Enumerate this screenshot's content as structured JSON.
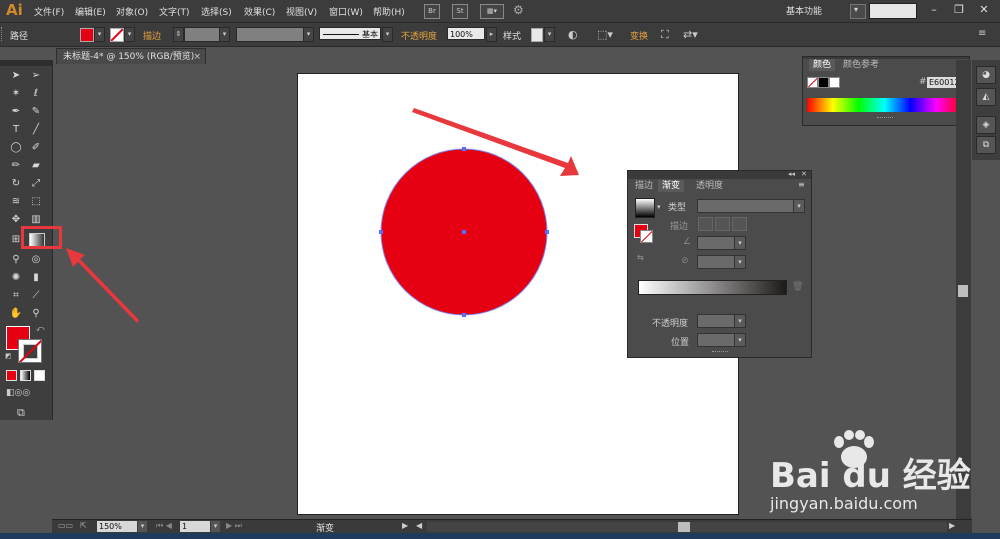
{
  "app": {
    "logo": "Ai"
  },
  "menu": [
    "文件(F)",
    "编辑(E)",
    "对象(O)",
    "文字(T)",
    "选择(S)",
    "效果(C)",
    "视图(V)",
    "窗口(W)",
    "帮助(H)"
  ],
  "menu_icons": {
    "br": "Br",
    "st": "St"
  },
  "workspace": {
    "label": "基本功能"
  },
  "window_controls": {
    "minimize": "–",
    "restore": "❐",
    "close": "✕"
  },
  "control_bar": {
    "object_type": "路径",
    "stroke_label": "描边",
    "stroke_style": "基本",
    "opacity_label": "不透明度",
    "opacity_value": "100%",
    "style_label": "样式",
    "transform_label": "变换"
  },
  "document": {
    "tab_title": "未标题-4* @ 150% (RGB/预览)",
    "close": "×"
  },
  "status_bar": {
    "zoom": "150%",
    "page": "1",
    "tool_name": "渐变"
  },
  "color_panel": {
    "tabs": [
      "颜色",
      "颜色参考"
    ],
    "hash": "#",
    "hex": "E60012"
  },
  "gradient_panel": {
    "tabs": [
      "描边",
      "渐变",
      "透明度"
    ],
    "type_label": "类型",
    "stroke_label": "描边",
    "opacity_label": "不透明度",
    "location_label": "位置"
  },
  "watermark": {
    "brand": "Bai du 经验",
    "url": "jingyan.baidu.com"
  },
  "colors": {
    "fill": "#e50012",
    "annotation": "#e8383d",
    "ui_dark": "#3c3c3c",
    "canvas_bg": "#535353"
  }
}
